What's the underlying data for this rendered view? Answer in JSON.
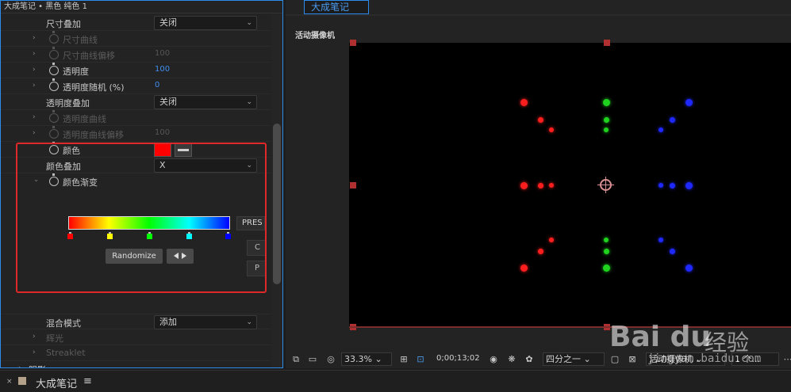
{
  "left_panel": {
    "title": "大成笔记 • 黑色 纯色 1",
    "rows": [
      {
        "label": "尺寸叠加",
        "dropdown": "关闭"
      },
      {
        "label": "尺寸曲线",
        "value": ""
      },
      {
        "label": "尺寸曲线偏移",
        "value": "100"
      },
      {
        "label": "透明度",
        "value": "100"
      },
      {
        "label": "透明度随机 (%)",
        "value": "0"
      },
      {
        "label": "透明度叠加",
        "dropdown": "关闭"
      },
      {
        "label": "透明度曲线",
        "value": ""
      },
      {
        "label": "透明度曲线偏移",
        "value": "100"
      },
      {
        "label": "颜色"
      },
      {
        "label": "颜色叠加",
        "dropdown": "X"
      },
      {
        "label": "颜色渐变"
      },
      {
        "label": "混合模式",
        "dropdown": "添加"
      },
      {
        "label": "辉光"
      },
      {
        "label": "Streaklet"
      },
      {
        "label": "阴影"
      }
    ],
    "color_value": "#ff0000",
    "gradient": {
      "stops": [
        "#ff0000",
        "#ffff00",
        "#00ff00",
        "#00ffff",
        "#0000ff"
      ],
      "presets_label": "PRES",
      "randomize_label": "Randomize",
      "side_btn_1": "C",
      "side_btn_2": "P"
    }
  },
  "comp": {
    "tab": "大成笔记",
    "camera_label": "活动摄像机",
    "dot_colors": {
      "red": "#ff1e1e",
      "green": "#1ed21e",
      "blue": "#1e28ff"
    },
    "toolbar": {
      "zoom": "33.3%",
      "timecode": "0;00;13;02",
      "resolution": "四分之一",
      "camera": "活动摄像机",
      "views": "1 个..."
    }
  },
  "footer": {
    "close": "×",
    "title": "大成笔记",
    "menu": "≡"
  },
  "watermark": {
    "brand": "Bai du",
    "text": "经验",
    "url": "jingyan.baidu.com"
  }
}
